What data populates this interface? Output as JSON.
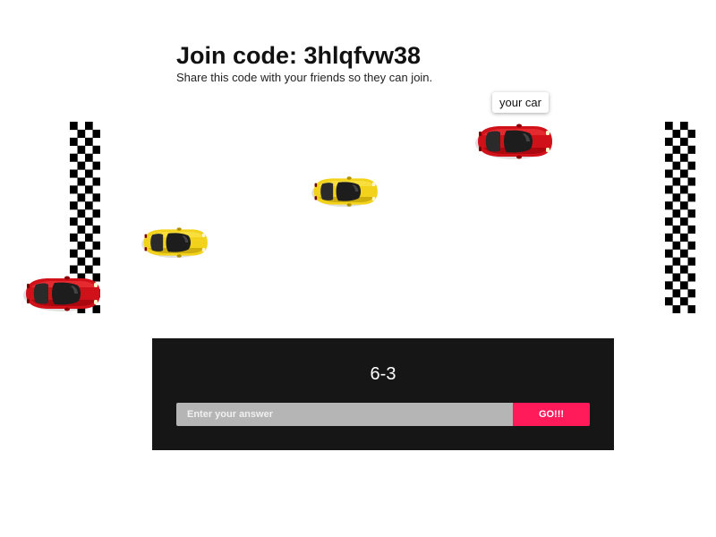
{
  "header": {
    "join_code_label": "Join code: 3hlqfvw38",
    "share_text": "Share this code with your friends so they can join."
  },
  "race": {
    "tooltip": "your car",
    "cars": [
      {
        "name": "player-car",
        "color": "red",
        "body": "#d0111a",
        "highlight": "#ff4a4a",
        "shadow": "#8a0006"
      },
      {
        "name": "opponent-car-1",
        "color": "yellow",
        "body": "#f2d21b",
        "highlight": "#fff06a",
        "shadow": "#b08f00"
      },
      {
        "name": "opponent-car-2",
        "color": "yellow",
        "body": "#f2d21b",
        "highlight": "#fff06a",
        "shadow": "#b08f00"
      },
      {
        "name": "opponent-car-3",
        "color": "red",
        "body": "#d0111a",
        "highlight": "#ff4a4a",
        "shadow": "#8a0006"
      }
    ],
    "start_flag_icon": "checkered-flag-icon",
    "finish_flag_icon": "checkered-flag-icon"
  },
  "quiz": {
    "question": "6-3",
    "input_placeholder": "Enter your answer",
    "input_value": "",
    "submit_label": "GO!!!"
  },
  "colors": {
    "panel_bg": "#161616",
    "input_bg": "#b5b5b5",
    "go_button": "#ff1a5a"
  }
}
